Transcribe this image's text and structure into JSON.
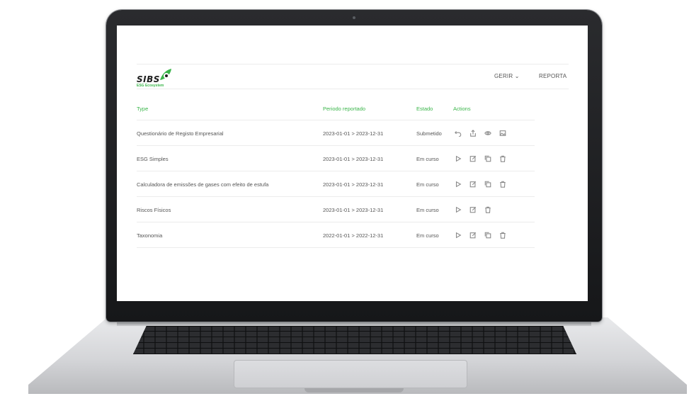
{
  "brand": {
    "name": "SIBS",
    "subtitle": "ESG Ecosystem",
    "accent_color": "#3ab54a"
  },
  "nav": {
    "gerir": "GERIR ⌄",
    "reporta": "REPORTA"
  },
  "table": {
    "headers": {
      "type": "Type",
      "period": "Periodo reportado",
      "state": "Estado",
      "actions": "Actions"
    },
    "rows": [
      {
        "type": "Questionário de Registo Empresarial",
        "period": "2023-01-01 > 2023-12-31",
        "state": "Submetido",
        "actions": [
          "undo-icon",
          "upload-icon",
          "eye-icon",
          "image-icon"
        ]
      },
      {
        "type": "ESG Simples",
        "period": "2023-01-01 > 2023-12-31",
        "state": "Em curso",
        "actions": [
          "play-icon",
          "edit-icon",
          "copy-icon",
          "trash-icon"
        ]
      },
      {
        "type": "Calculadora de emissões de gases com efeito de estufa",
        "period": "2023-01-01 > 2023-12-31",
        "state": "Em curso",
        "actions": [
          "play-icon",
          "edit-icon",
          "copy-icon",
          "trash-icon"
        ]
      },
      {
        "type": "Riscos Físicos",
        "period": "2023-01-01 > 2023-12-31",
        "state": "Em curso",
        "actions": [
          "play-icon",
          "edit-icon",
          "trash-icon"
        ]
      },
      {
        "type": "Taxonomia",
        "period": "2022-01-01 > 2022-12-31",
        "state": "Em curso",
        "actions": [
          "play-icon",
          "edit-icon",
          "copy-icon",
          "trash-icon"
        ]
      }
    ]
  }
}
